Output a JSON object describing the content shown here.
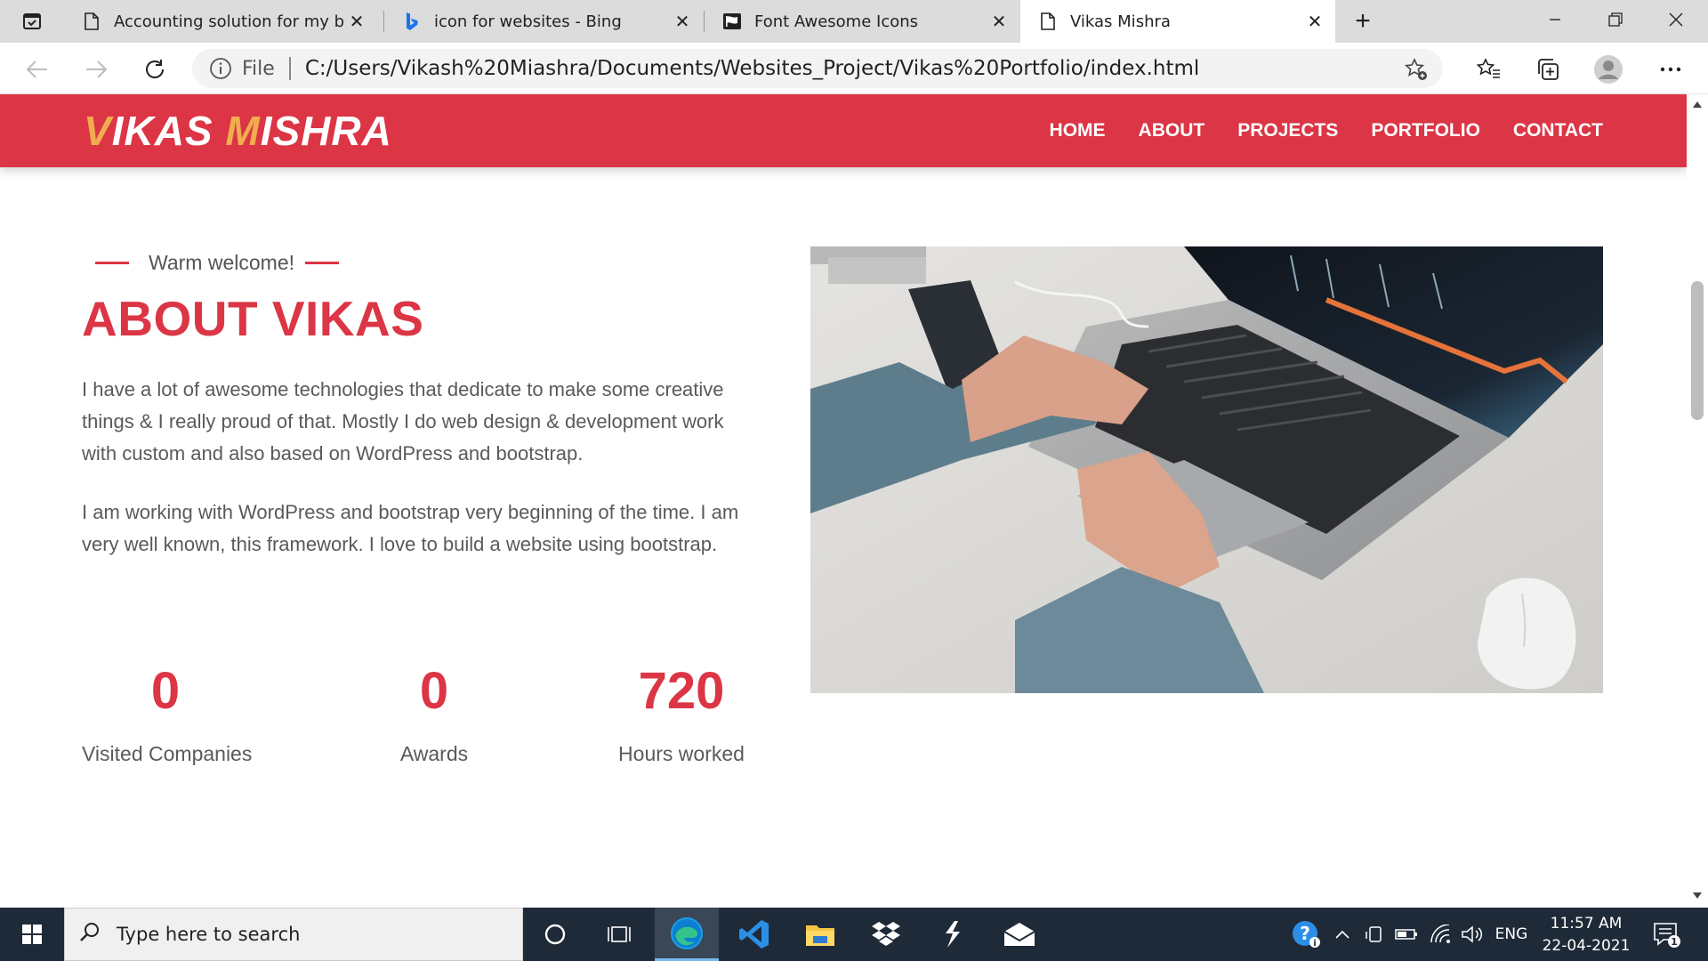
{
  "browser": {
    "tabs": [
      {
        "title": "Accounting solution for my busir",
        "icon": "document-icon"
      },
      {
        "title": "icon for websites - Bing",
        "icon": "bing-icon"
      },
      {
        "title": "Font Awesome Icons",
        "icon": "flag-icon"
      },
      {
        "title": "Vikas Mishra",
        "icon": "document-icon"
      }
    ],
    "file_label": "File",
    "url": "C:/Users/Vikash%20Miashra/Documents/Websites_Project/Vikas%20Portfolio/index.html"
  },
  "site": {
    "logo": {
      "v": "V",
      "ikas": "IKAS ",
      "m": "M",
      "ishra": "ISHRA"
    },
    "nav": [
      "HOME",
      "ABOUT",
      "PROJECTS",
      "PORTFOLIO",
      "CONTACT"
    ],
    "accent_color": "#dc3545",
    "logo_accent_color": "#f0ad4e"
  },
  "about": {
    "kicker": "Warm welcome!",
    "title": "ABOUT VIKAS",
    "paragraphs": [
      "I have a lot of awesome technologies that dedicate to make some creative things & I really proud of that. Mostly I do web design & development work with custom and also based on WordPress and bootstrap.",
      "I am working with WordPress and bootstrap very beginning of the time. I am very well known, this framework. I love to build a website using bootstrap."
    ],
    "stats": [
      {
        "value": "0",
        "label": "Visited Companies"
      },
      {
        "value": "0",
        "label": "Awards"
      },
      {
        "value": "720",
        "label": "Hours worked"
      }
    ]
  },
  "taskbar": {
    "search_placeholder": "Type here to search",
    "language": "ENG",
    "time": "11:57 AM",
    "date": "22-04-2021",
    "notification_count": "1"
  }
}
